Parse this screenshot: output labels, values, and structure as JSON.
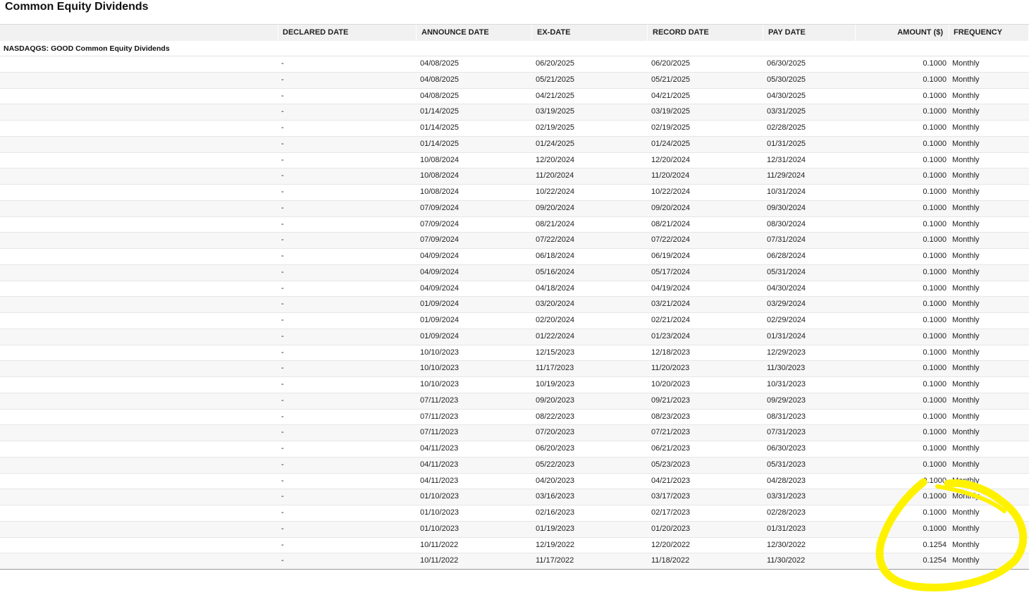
{
  "title": "Common Equity Dividends",
  "columns": [
    "",
    "DECLARED DATE",
    "ANNOUNCE DATE",
    "EX-DATE",
    "RECORD DATE",
    "PAY DATE",
    "AMOUNT ($)",
    "FREQUENCY"
  ],
  "group_label": "NASDAQGS: GOOD Common Equity Dividends",
  "rows": [
    [
      "-",
      "04/08/2025",
      "06/20/2025",
      "06/20/2025",
      "06/30/2025",
      "0.1000",
      "Monthly"
    ],
    [
      "-",
      "04/08/2025",
      "05/21/2025",
      "05/21/2025",
      "05/30/2025",
      "0.1000",
      "Monthly"
    ],
    [
      "-",
      "04/08/2025",
      "04/21/2025",
      "04/21/2025",
      "04/30/2025",
      "0.1000",
      "Monthly"
    ],
    [
      "-",
      "01/14/2025",
      "03/19/2025",
      "03/19/2025",
      "03/31/2025",
      "0.1000",
      "Monthly"
    ],
    [
      "-",
      "01/14/2025",
      "02/19/2025",
      "02/19/2025",
      "02/28/2025",
      "0.1000",
      "Monthly"
    ],
    [
      "-",
      "01/14/2025",
      "01/24/2025",
      "01/24/2025",
      "01/31/2025",
      "0.1000",
      "Monthly"
    ],
    [
      "-",
      "10/08/2024",
      "12/20/2024",
      "12/20/2024",
      "12/31/2024",
      "0.1000",
      "Monthly"
    ],
    [
      "-",
      "10/08/2024",
      "11/20/2024",
      "11/20/2024",
      "11/29/2024",
      "0.1000",
      "Monthly"
    ],
    [
      "-",
      "10/08/2024",
      "10/22/2024",
      "10/22/2024",
      "10/31/2024",
      "0.1000",
      "Monthly"
    ],
    [
      "-",
      "07/09/2024",
      "09/20/2024",
      "09/20/2024",
      "09/30/2024",
      "0.1000",
      "Monthly"
    ],
    [
      "-",
      "07/09/2024",
      "08/21/2024",
      "08/21/2024",
      "08/30/2024",
      "0.1000",
      "Monthly"
    ],
    [
      "-",
      "07/09/2024",
      "07/22/2024",
      "07/22/2024",
      "07/31/2024",
      "0.1000",
      "Monthly"
    ],
    [
      "-",
      "04/09/2024",
      "06/18/2024",
      "06/19/2024",
      "06/28/2024",
      "0.1000",
      "Monthly"
    ],
    [
      "-",
      "04/09/2024",
      "05/16/2024",
      "05/17/2024",
      "05/31/2024",
      "0.1000",
      "Monthly"
    ],
    [
      "-",
      "04/09/2024",
      "04/18/2024",
      "04/19/2024",
      "04/30/2024",
      "0.1000",
      "Monthly"
    ],
    [
      "-",
      "01/09/2024",
      "03/20/2024",
      "03/21/2024",
      "03/29/2024",
      "0.1000",
      "Monthly"
    ],
    [
      "-",
      "01/09/2024",
      "02/20/2024",
      "02/21/2024",
      "02/29/2024",
      "0.1000",
      "Monthly"
    ],
    [
      "-",
      "01/09/2024",
      "01/22/2024",
      "01/23/2024",
      "01/31/2024",
      "0.1000",
      "Monthly"
    ],
    [
      "-",
      "10/10/2023",
      "12/15/2023",
      "12/18/2023",
      "12/29/2023",
      "0.1000",
      "Monthly"
    ],
    [
      "-",
      "10/10/2023",
      "11/17/2023",
      "11/20/2023",
      "11/30/2023",
      "0.1000",
      "Monthly"
    ],
    [
      "-",
      "10/10/2023",
      "10/19/2023",
      "10/20/2023",
      "10/31/2023",
      "0.1000",
      "Monthly"
    ],
    [
      "-",
      "07/11/2023",
      "09/20/2023",
      "09/21/2023",
      "09/29/2023",
      "0.1000",
      "Monthly"
    ],
    [
      "-",
      "07/11/2023",
      "08/22/2023",
      "08/23/2023",
      "08/31/2023",
      "0.1000",
      "Monthly"
    ],
    [
      "-",
      "07/11/2023",
      "07/20/2023",
      "07/21/2023",
      "07/31/2023",
      "0.1000",
      "Monthly"
    ],
    [
      "-",
      "04/11/2023",
      "06/20/2023",
      "06/21/2023",
      "06/30/2023",
      "0.1000",
      "Monthly"
    ],
    [
      "-",
      "04/11/2023",
      "05/22/2023",
      "05/23/2023",
      "05/31/2023",
      "0.1000",
      "Monthly"
    ],
    [
      "-",
      "04/11/2023",
      "04/20/2023",
      "04/21/2023",
      "04/28/2023",
      "0.1000",
      "Monthly"
    ],
    [
      "-",
      "01/10/2023",
      "03/16/2023",
      "03/17/2023",
      "03/31/2023",
      "0.1000",
      "Monthly"
    ],
    [
      "-",
      "01/10/2023",
      "02/16/2023",
      "02/17/2023",
      "02/28/2023",
      "0.1000",
      "Monthly"
    ],
    [
      "-",
      "01/10/2023",
      "01/19/2023",
      "01/20/2023",
      "01/31/2023",
      "0.1000",
      "Monthly"
    ],
    [
      "-",
      "10/11/2022",
      "12/19/2022",
      "12/20/2022",
      "12/30/2022",
      "0.1254",
      "Monthly"
    ],
    [
      "-",
      "10/11/2022",
      "11/17/2022",
      "11/18/2022",
      "11/30/2022",
      "0.1254",
      "Monthly"
    ]
  ],
  "annotation_color": "#fff200"
}
